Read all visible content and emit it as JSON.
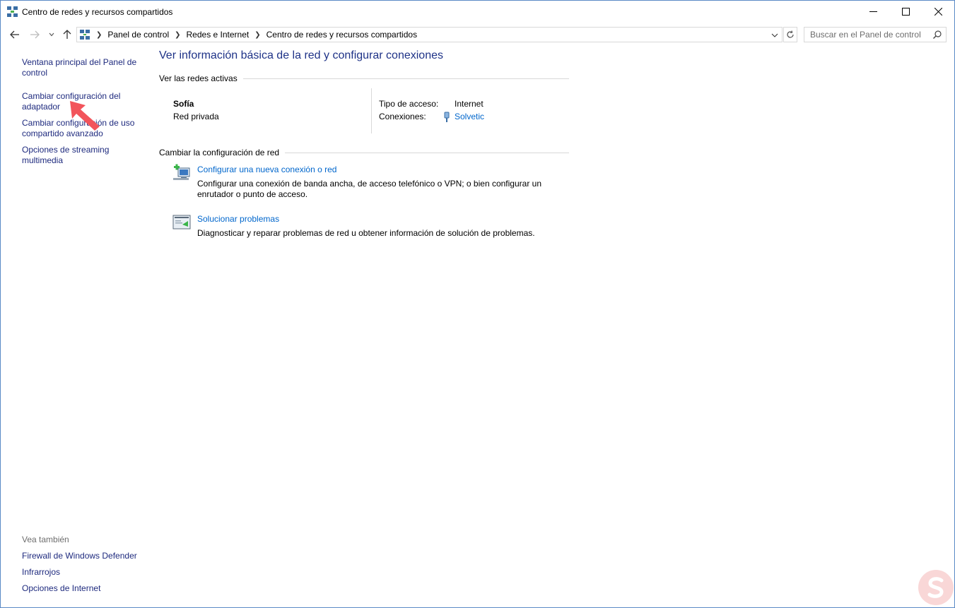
{
  "window": {
    "title": "Centro de redes y recursos compartidos"
  },
  "address": {
    "crumbs": [
      "Panel de control",
      "Redes e Internet",
      "Centro de redes y recursos compartidos"
    ]
  },
  "search": {
    "placeholder": "Buscar en el Panel de control"
  },
  "left_pane": {
    "links": [
      "Ventana principal del Panel de control",
      "Cambiar configuración del adaptador",
      "Cambiar configuración de uso compartido avanzado",
      "Opciones de streaming multimedia"
    ],
    "see_also_heading": "Vea también",
    "see_also": [
      "Firewall de Windows Defender",
      "Infrarrojos",
      "Opciones de Internet"
    ]
  },
  "main": {
    "title": "Ver información básica de la red y configurar conexiones",
    "active_networks_heading": "Ver las redes activas",
    "network": {
      "name": "Sofía",
      "category": "Red privada",
      "access_type_label": "Tipo de acceso:",
      "access_type_value": "Internet",
      "connections_label": "Conexiones:",
      "connection_name": "Solvetic"
    },
    "change_heading": "Cambiar la configuración de red",
    "tasks": [
      {
        "icon": "network-setup-icon",
        "title": "Configurar una nueva conexión o red",
        "description": "Configurar una conexión de banda ancha, de acceso telefónico o VPN; o bien configurar un enrutador o punto de acceso."
      },
      {
        "icon": "troubleshoot-icon",
        "title": "Solucionar problemas",
        "description": "Diagnosticar y reparar problemas de red u obtener información de solución de problemas."
      }
    ]
  },
  "colors": {
    "link_nav": "#1e2a7e",
    "link_task": "#0066cc",
    "title_blue": "#1e3287",
    "annotation_arrow": "#f2545b"
  }
}
